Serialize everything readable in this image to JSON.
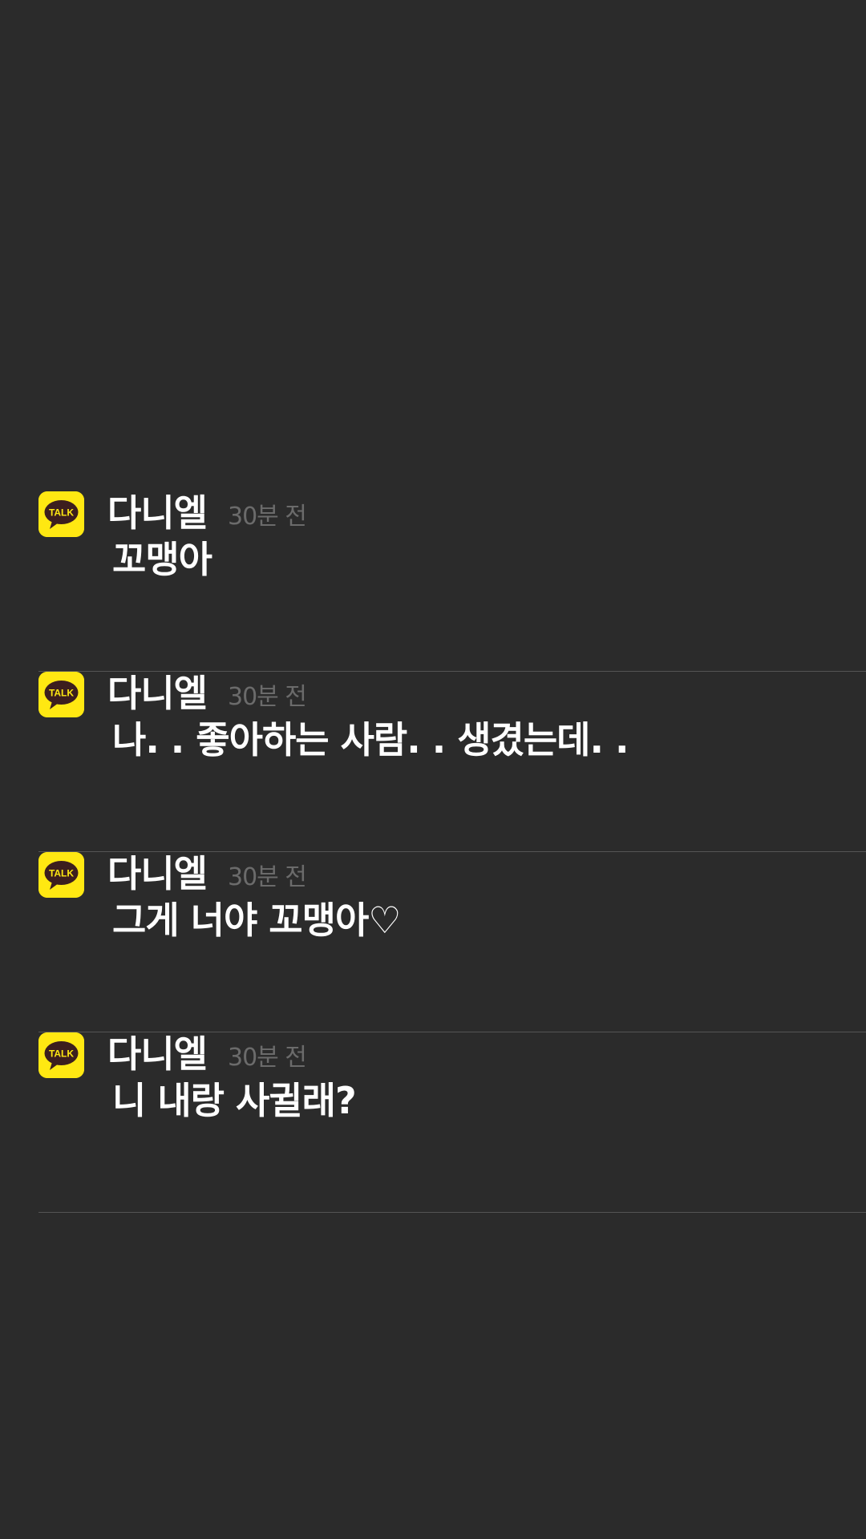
{
  "app": {
    "icon_name": "kakaotalk-talk-icon",
    "icon_text": "TALK",
    "icon_color": "#ffe812",
    "bubble_color": "#3c1e1e"
  },
  "notifications": [
    {
      "sender": "다니엘",
      "time": "30분 전",
      "message": "꼬맹아"
    },
    {
      "sender": "다니엘",
      "time": "30분 전",
      "message": "나. . 좋아하는 사람. . 생겼는데. ."
    },
    {
      "sender": "다니엘",
      "time": "30분 전",
      "message": "그게 너야 꼬맹아♡"
    },
    {
      "sender": "다니엘",
      "time": "30분 전",
      "message": "니 내랑 사귈래?"
    }
  ]
}
